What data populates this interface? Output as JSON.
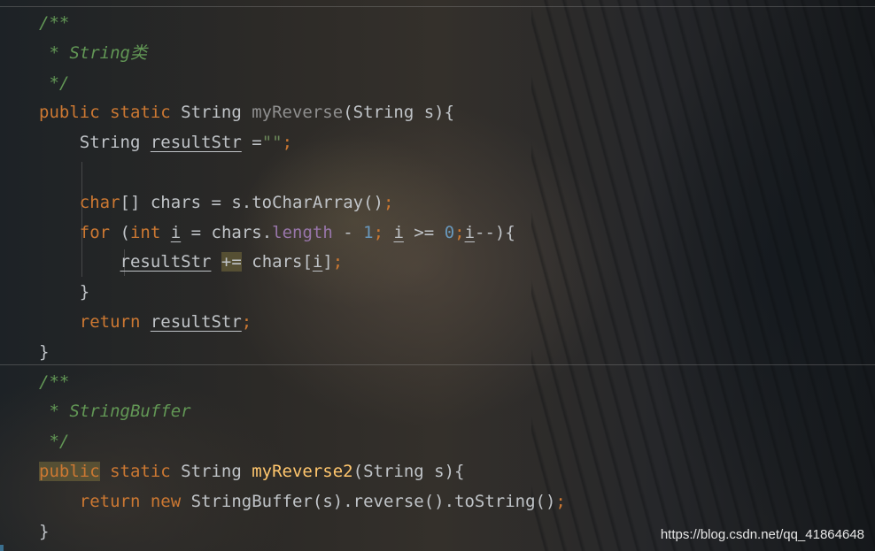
{
  "editor": {
    "lines": [
      {
        "tokens": [
          {
            "t": "/**",
            "c": "comment"
          }
        ]
      },
      {
        "tokens": [
          {
            "t": " * String类",
            "c": "comment"
          }
        ]
      },
      {
        "tokens": [
          {
            "t": " */",
            "c": "comment"
          }
        ]
      },
      {
        "tokens": [
          {
            "t": "public static ",
            "c": "kw"
          },
          {
            "t": "String ",
            "c": "type"
          },
          {
            "t": "myReverse",
            "c": "fn-dim"
          },
          {
            "t": "(String s){",
            "c": "type"
          }
        ]
      },
      {
        "tokens": [
          {
            "t": "    String ",
            "c": "type"
          },
          {
            "t": "resultStr",
            "c": "type ul"
          },
          {
            "t": " =",
            "c": "type"
          },
          {
            "t": "\"\"",
            "c": "str"
          },
          {
            "t": ";",
            "c": "kw"
          }
        ]
      },
      {
        "tokens": []
      },
      {
        "tokens": [
          {
            "t": "    ",
            "c": "type"
          },
          {
            "t": "char",
            "c": "kw"
          },
          {
            "t": "[] chars = s.toCharArray()",
            "c": "type"
          },
          {
            "t": ";",
            "c": "kw"
          }
        ]
      },
      {
        "tokens": [
          {
            "t": "    ",
            "c": "type"
          },
          {
            "t": "for ",
            "c": "kw"
          },
          {
            "t": "(",
            "c": "type"
          },
          {
            "t": "int ",
            "c": "kw"
          },
          {
            "t": "i",
            "c": "type ul"
          },
          {
            "t": " = chars.",
            "c": "type"
          },
          {
            "t": "length",
            "c": "field"
          },
          {
            "t": " - ",
            "c": "type"
          },
          {
            "t": "1",
            "c": "num"
          },
          {
            "t": "; ",
            "c": "kw"
          },
          {
            "t": "i",
            "c": "type ul"
          },
          {
            "t": " >= ",
            "c": "type"
          },
          {
            "t": "0",
            "c": "num"
          },
          {
            "t": ";",
            "c": "kw"
          },
          {
            "t": "i",
            "c": "type ul"
          },
          {
            "t": "--){",
            "c": "type"
          }
        ]
      },
      {
        "tokens": [
          {
            "t": "        ",
            "c": "type"
          },
          {
            "t": "resultStr",
            "c": "type ul"
          },
          {
            "t": " ",
            "c": "type"
          },
          {
            "t": "+=",
            "c": "type hl"
          },
          {
            "t": " chars[",
            "c": "type"
          },
          {
            "t": "i",
            "c": "type ul"
          },
          {
            "t": "]",
            "c": "type"
          },
          {
            "t": ";",
            "c": "kw"
          }
        ]
      },
      {
        "tokens": [
          {
            "t": "    }",
            "c": "type"
          }
        ]
      },
      {
        "tokens": [
          {
            "t": "    ",
            "c": "type"
          },
          {
            "t": "return ",
            "c": "kw"
          },
          {
            "t": "resultStr",
            "c": "type ul"
          },
          {
            "t": ";",
            "c": "kw"
          }
        ]
      },
      {
        "tokens": [
          {
            "t": "}",
            "c": "type"
          }
        ]
      },
      {
        "tokens": [
          {
            "t": "/**",
            "c": "comment"
          }
        ]
      },
      {
        "tokens": [
          {
            "t": " * StringBuffer",
            "c": "comment"
          }
        ]
      },
      {
        "tokens": [
          {
            "t": " */",
            "c": "comment"
          }
        ]
      },
      {
        "tokens": [
          {
            "t": "public",
            "c": "kw hl"
          },
          {
            "t": " static ",
            "c": "kw"
          },
          {
            "t": "String ",
            "c": "type"
          },
          {
            "t": "myReverse2",
            "c": "fn"
          },
          {
            "t": "(String s){",
            "c": "type"
          }
        ]
      },
      {
        "tokens": [
          {
            "t": "    ",
            "c": "type"
          },
          {
            "t": "return new ",
            "c": "kw"
          },
          {
            "t": "StringBuffer(s).reverse().toString()",
            "c": "type"
          },
          {
            "t": ";",
            "c": "kw"
          }
        ]
      },
      {
        "tokens": [
          {
            "t": "}",
            "c": "type"
          }
        ]
      }
    ]
  },
  "watermark": "https://blog.csdn.net/qq_41864648"
}
